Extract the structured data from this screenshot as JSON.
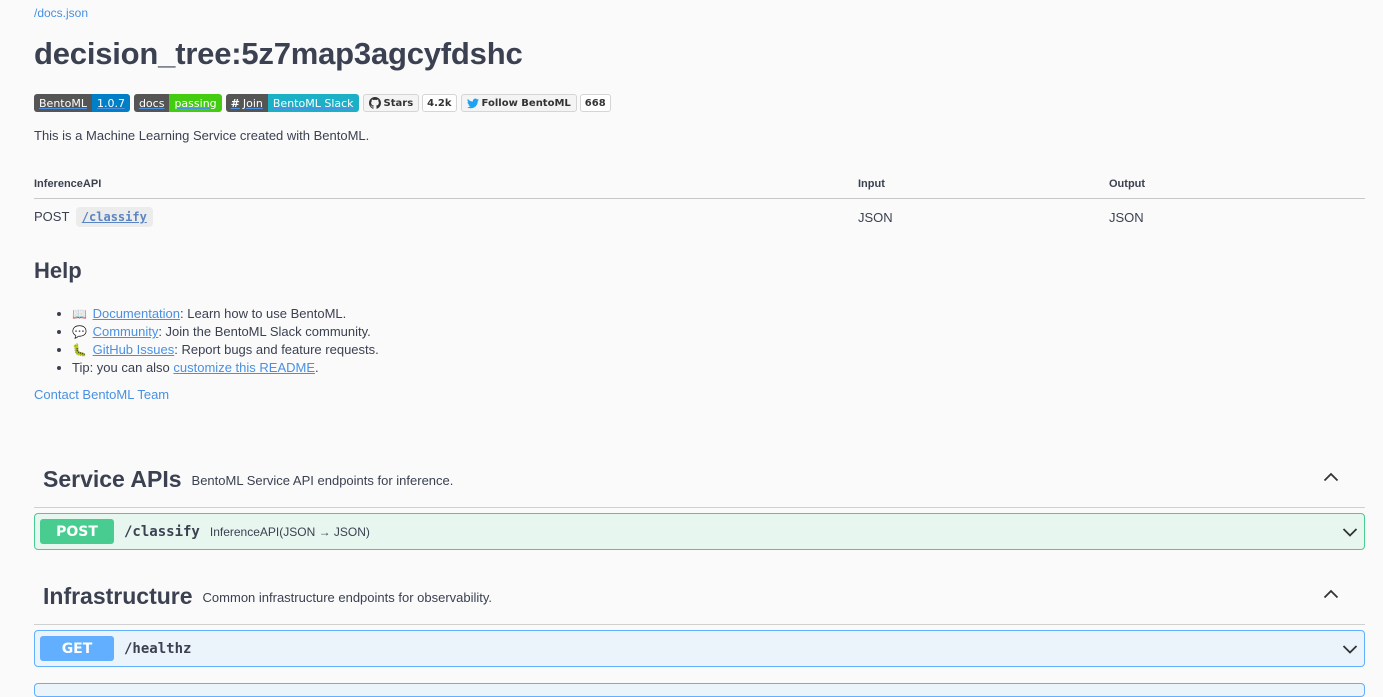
{
  "docs_link": "/docs.json",
  "title": "decision_tree:5z7map3agcyfdshc",
  "badges": {
    "bentoml_left": "BentoML",
    "bentoml_right": "1.0.7",
    "docs_left": "docs",
    "docs_right": "passing",
    "join_left": "Join",
    "join_right": "BentoML Slack",
    "stars_label": "Stars",
    "stars_count": "4.2k",
    "follow_label": "Follow BentoML",
    "follow_count": "668"
  },
  "description": "This is a Machine Learning Service created with BentoML.",
  "api_table": {
    "headers": [
      "InferenceAPI",
      "Input",
      "Output"
    ],
    "rows": [
      {
        "method": "POST",
        "path": "/classify",
        "input": "JSON",
        "output": "JSON"
      }
    ]
  },
  "help": {
    "heading": "Help",
    "items": [
      {
        "emoji": "📖",
        "link": "Documentation",
        "text": ": Learn how to use BentoML."
      },
      {
        "emoji": "💬",
        "link": "Community",
        "text": ": Join the BentoML Slack community."
      },
      {
        "emoji": "🐛",
        "link": "GitHub Issues",
        "text": ": Report bugs and feature requests."
      }
    ],
    "tip_prefix": "Tip: you can also ",
    "tip_link": "customize this README",
    "tip_suffix": "."
  },
  "contact": "Contact BentoML Team",
  "sections": [
    {
      "title": "Service APIs",
      "description": "BentoML Service API endpoints for inference.",
      "ops": [
        {
          "method": "POST",
          "path": "/classify",
          "summary": "InferenceAPI(JSON → JSON)"
        }
      ]
    },
    {
      "title": "Infrastructure",
      "description": "Common infrastructure endpoints for observability.",
      "ops": [
        {
          "method": "GET",
          "path": "/healthz",
          "summary": ""
        }
      ]
    }
  ],
  "colors": {
    "post": "#49cc90",
    "get": "#61affe",
    "link": "#4990e2",
    "text": "#3b4151"
  }
}
